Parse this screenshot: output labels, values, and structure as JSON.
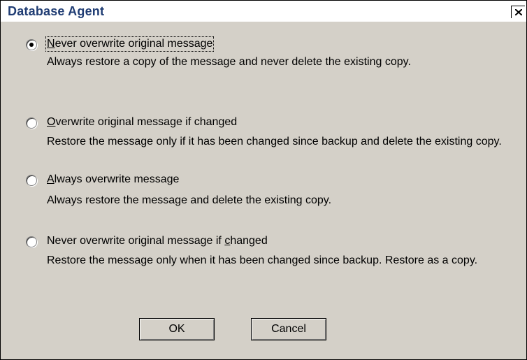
{
  "dialog": {
    "title": "Database Agent",
    "close_icon": "close-x-icon"
  },
  "options": [
    {
      "label_pre": "",
      "mnemonic": "N",
      "label_post": "ever overwrite original message",
      "description": "Always restore a copy of the message and never delete the existing copy.",
      "selected": true
    },
    {
      "label_pre": "",
      "mnemonic": "O",
      "label_post": "verwrite original message if changed",
      "description": "Restore the message only if it has been changed since backup and delete the existing copy.",
      "selected": false
    },
    {
      "label_pre": "",
      "mnemonic": "A",
      "label_post": "lways overwrite message",
      "description": "Always restore the message and delete the existing copy.",
      "selected": false
    },
    {
      "label_pre": "Never overwrite original message if ",
      "mnemonic": "c",
      "label_post": "hanged",
      "description": "Restore the message only when it has been changed since backup. Restore as a copy.",
      "selected": false
    }
  ],
  "buttons": {
    "ok": "OK",
    "cancel": "Cancel"
  }
}
